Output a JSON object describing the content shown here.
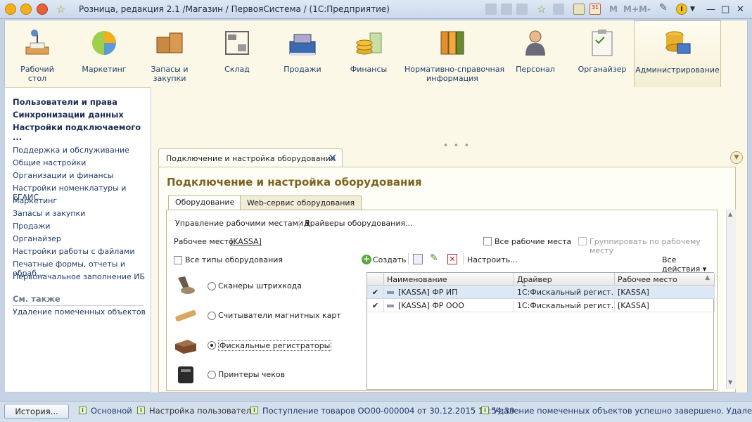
{
  "window": {
    "title": "Розница, редакция 2.1 /Магазин / ПервояСистема / (1С:Предприятие)",
    "memory": [
      "M",
      "M+",
      "M-"
    ]
  },
  "sections": [
    {
      "label": "Рабочий\nстол",
      "icon": "desk-lamp-icon"
    },
    {
      "label": "Маркетинг",
      "icon": "pie-chart-icon"
    },
    {
      "label": "Запасы и\nзакупки",
      "icon": "boxes-icon"
    },
    {
      "label": "Склад",
      "icon": "warehouse-shelf-icon"
    },
    {
      "label": "Продажи",
      "icon": "cash-register-icon"
    },
    {
      "label": "Финансы",
      "icon": "coins-icon"
    },
    {
      "label": "Нормативно-справочная\nинформация",
      "icon": "binders-icon"
    },
    {
      "label": "Персонал",
      "icon": "person-icon"
    },
    {
      "label": "Органайзер",
      "icon": "clipboard-icon"
    },
    {
      "label": "Администрирование",
      "icon": "database-monitor-icon"
    }
  ],
  "left_nav": {
    "bold": [
      "Пользователи и права",
      "Синхронизации данных",
      "Настройки подключаемого ..."
    ],
    "items": [
      "Поддержка и обслуживание",
      "Общие настройки",
      "Организации и финансы",
      "Настройки номенклатуры и ЕГАИС",
      "Маркетинг",
      "Запасы и закупки",
      "Продажи",
      "Органайзер",
      "Настройки работы с файлами",
      "Печатные формы, отчеты и обраб...",
      "Первоначальное заполнение ИБ"
    ],
    "see_also_title": "См. также",
    "see_also": [
      "Удаление помеченных объектов"
    ]
  },
  "form": {
    "tab_label": "Подключение и настройка оборудования",
    "title": "Подключение и настройка оборудования",
    "tabs": [
      "Оборудование",
      "Web-сервис оборудования"
    ],
    "toolbar1": {
      "workplaces": "Управление рабочими местами",
      "drivers": "Драйверы оборудования..."
    },
    "workplace_label": "Рабочее место:",
    "workplace_value": "[KASSA]",
    "all_workplaces": "Все рабочие места",
    "group_by_workplace": "Группировать по рабочему месту",
    "all_types": "Все типы оборудования",
    "device_types": [
      {
        "label": "Сканеры штрихкода",
        "selected": false
      },
      {
        "label": "Считыватели магнитных карт",
        "selected": false
      },
      {
        "label": "Фискальные регистраторы",
        "selected": true
      },
      {
        "label": "Принтеры чеков",
        "selected": false
      }
    ],
    "grid_toolbar": {
      "create": "Создать",
      "configure": "Настроить...",
      "all_actions": "Все действия"
    },
    "columns": [
      "Наименование",
      "Драйвер оборудования",
      "Рабочее место"
    ],
    "rows": [
      {
        "name": "[KASSA] ФР ИП",
        "driver": "1С:Фискальный регист...",
        "workplace": "[KASSA]",
        "selected": true
      },
      {
        "name": "[KASSA] ФР ООО",
        "driver": "1С:Фискальный регист...",
        "workplace": "[KASSA]",
        "selected": false
      }
    ]
  },
  "statusbar": {
    "history": "История...",
    "items": [
      "Основной",
      "Настройка пользователя",
      "Поступление товаров ОО00-000004 от 30.12.2015 16:54:39",
      "Удаление помеченных объектов успешно завершено. Удале..."
    ]
  },
  "colors": {
    "accent_title": "#7b6320",
    "link": "#1f3b66",
    "panel_bg": "#fbf8e8",
    "selected_row": "#dde8f6"
  }
}
